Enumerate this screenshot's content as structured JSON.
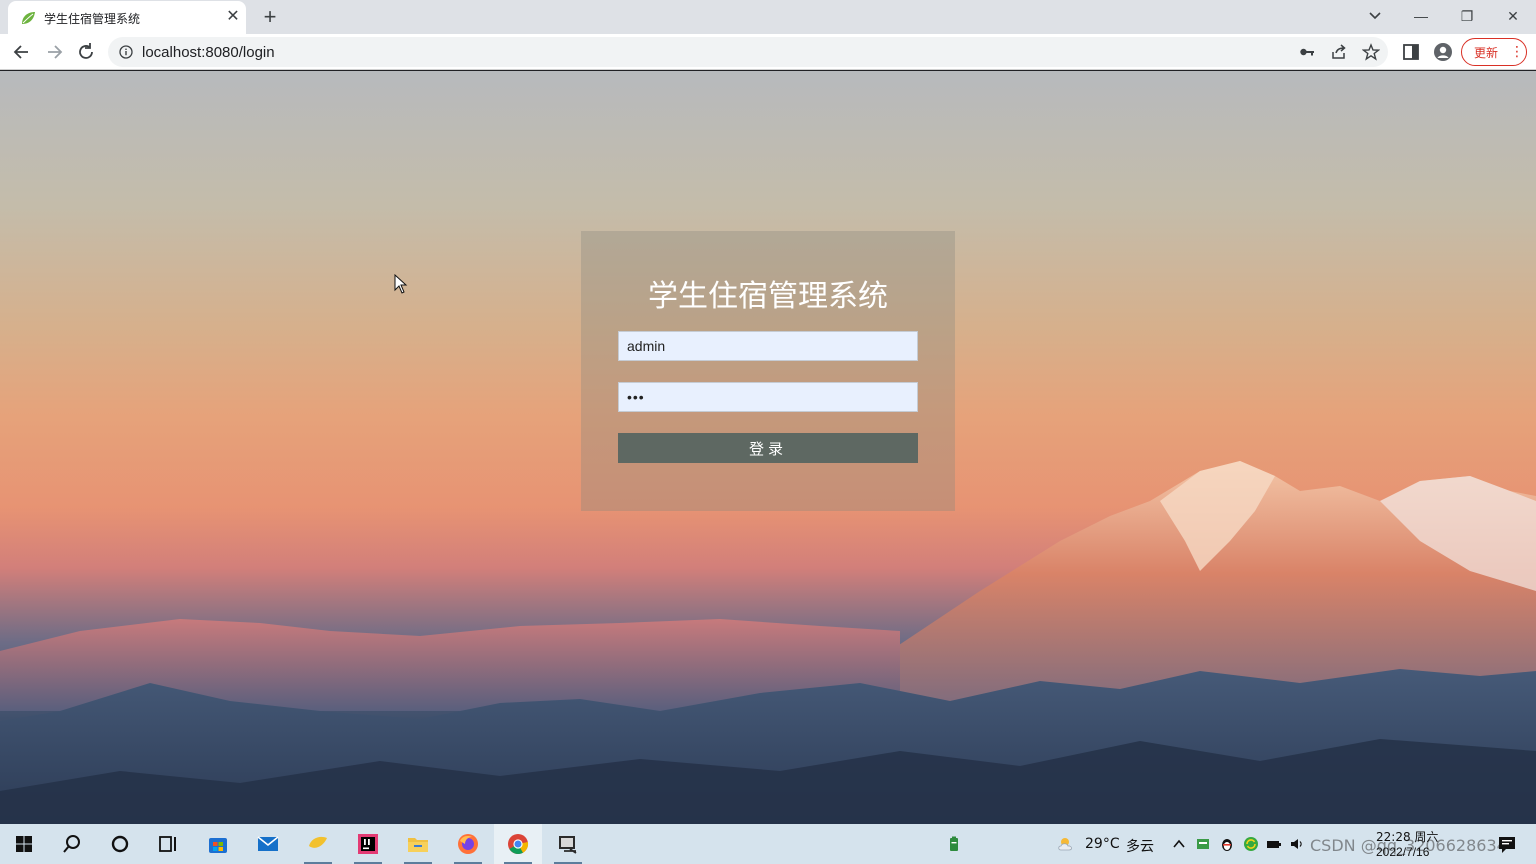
{
  "browser": {
    "tab_title": "学生住宿管理系统",
    "tab_close": "✕",
    "new_tab": "+",
    "url": "localhost:8080/login",
    "update_label": "更新",
    "update_menu": "⋮",
    "window_minimize": "—",
    "window_restore": "❐",
    "window_close": "✕"
  },
  "login": {
    "title": "学生住宿管理系统",
    "username_value": "admin",
    "password_value": "•••",
    "submit_label": "登录"
  },
  "taskbar": {
    "weather_temp": "29°C",
    "weather_desc": "多云",
    "clock_time": "22:28 周六",
    "clock_date": "2022/7/16",
    "watermark": "CSDN @qq_3206628634"
  },
  "icons": {
    "tab_favicon": "spring-leaf-icon",
    "back": "arrow-left-icon",
    "forward": "arrow-right-icon",
    "reload": "reload-icon",
    "site_info": "info-icon",
    "password_key": "key-icon",
    "share": "share-icon",
    "bookmark": "star-icon",
    "side_panel": "side-panel-icon",
    "profile": "profile-icon"
  },
  "colors": {
    "update_red": "#d93025",
    "login_button": "#5e6862",
    "input_autofill": "#e8f0fe"
  }
}
